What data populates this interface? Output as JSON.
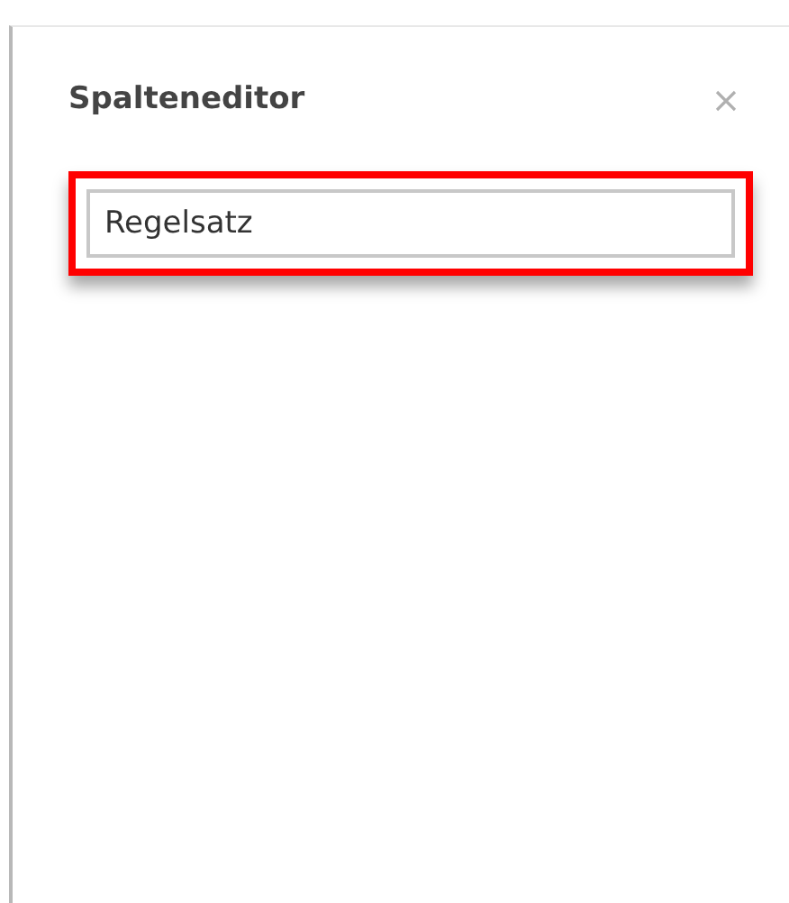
{
  "panel": {
    "title": "Spalteneditor"
  },
  "field": {
    "value": "Regelsatz",
    "highlighted": true
  }
}
